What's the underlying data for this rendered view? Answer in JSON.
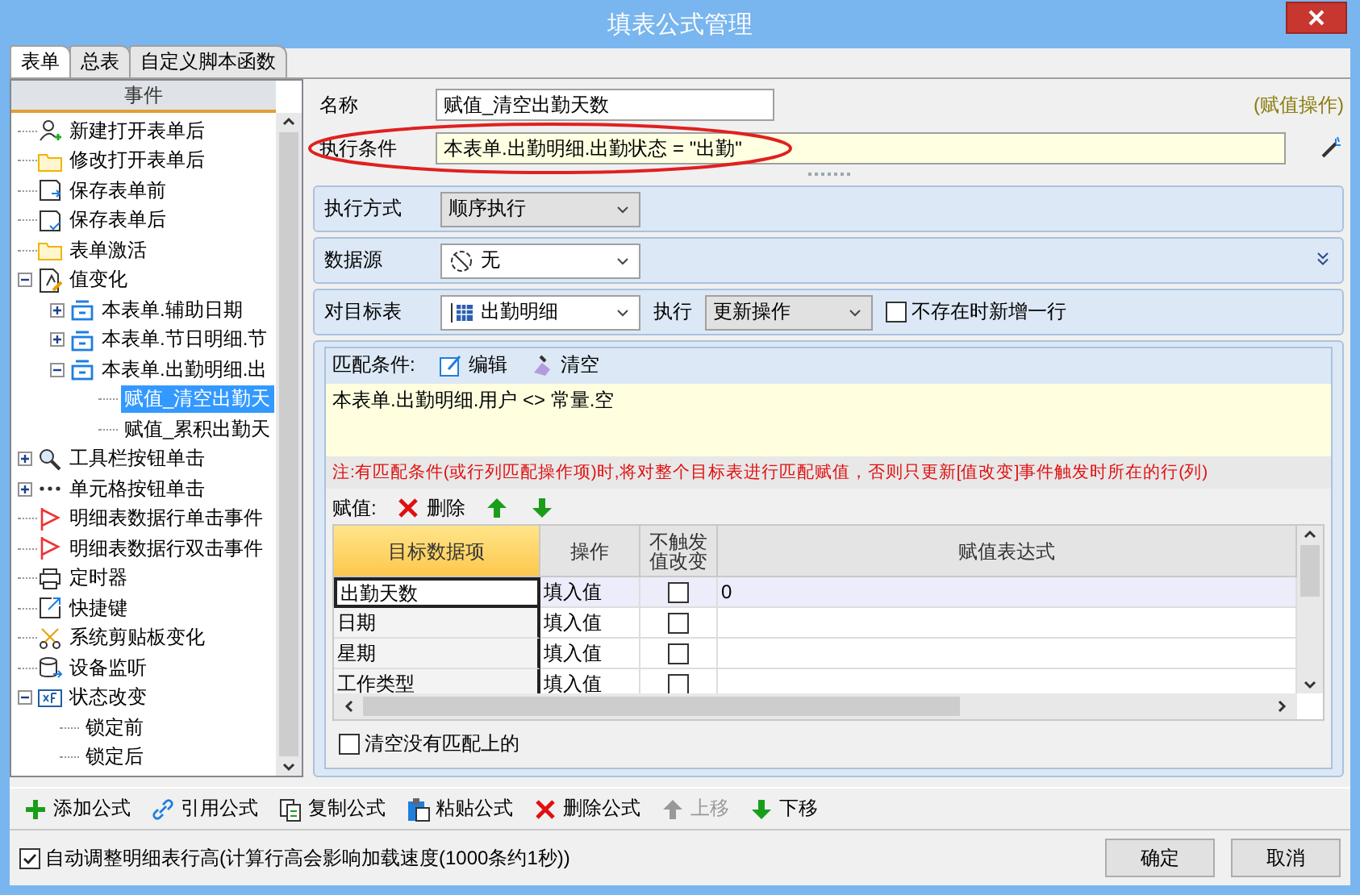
{
  "window": {
    "title": "填表公式管理"
  },
  "tabs": [
    {
      "label": "表单",
      "selected": true
    },
    {
      "label": "总表",
      "selected": false
    },
    {
      "label": "自定义脚本函数",
      "selected": false
    }
  ],
  "event_tree": {
    "header": "事件",
    "items": [
      {
        "label": "新建打开表单后",
        "selected": false
      },
      {
        "label": "修改打开表单后",
        "selected": false
      },
      {
        "label": "保存表单前",
        "selected": false
      },
      {
        "label": "保存表单后",
        "selected": false
      },
      {
        "label": "表单激活",
        "selected": false
      },
      {
        "label": "值变化",
        "selected": false,
        "expanded": true,
        "children": [
          {
            "label": "本表单.辅助日期",
            "selected": false,
            "expanded": false
          },
          {
            "label": "本表单.节日明细.节",
            "selected": false,
            "expanded": false
          },
          {
            "label": "本表单.出勤明细.出",
            "selected": false,
            "expanded": true,
            "children": [
              {
                "label": "赋值_清空出勤天",
                "selected": true
              },
              {
                "label": "赋值_累积出勤天",
                "selected": false
              }
            ]
          }
        ]
      },
      {
        "label": "工具栏按钮单击",
        "selected": false,
        "expanded": false
      },
      {
        "label": "单元格按钮单击",
        "selected": false,
        "expanded": false
      },
      {
        "label": "明细表数据行单击事件",
        "selected": false
      },
      {
        "label": "明细表数据行双击事件",
        "selected": false
      },
      {
        "label": "定时器",
        "selected": false
      },
      {
        "label": "快捷键",
        "selected": false
      },
      {
        "label": "系统剪贴板变化",
        "selected": false
      },
      {
        "label": "设备监听",
        "selected": false
      },
      {
        "label": "状态改变",
        "selected": false,
        "expanded": true,
        "children": [
          {
            "label": "锁定前",
            "selected": false
          },
          {
            "label": "锁定后",
            "selected": false
          }
        ]
      }
    ]
  },
  "form": {
    "name_label": "名称",
    "name_value": "赋值_清空出勤天数",
    "operation_type": "(赋值操作)",
    "condition_label": "执行条件",
    "condition_value": "本表单.出勤明细.出勤状态 = \"出勤\""
  },
  "exec_mode": {
    "label": "执行方式",
    "value": "顺序执行"
  },
  "datasource": {
    "label": "数据源",
    "value": "无"
  },
  "target": {
    "label": "对目标表",
    "value": "出勤明细",
    "exec_label": "执行",
    "exec_value": "更新操作",
    "add_row": {
      "label": "不存在时新增一行",
      "checked": false
    }
  },
  "match": {
    "label": "匹配条件:",
    "buttons": [
      "编辑",
      "清空"
    ],
    "expression": "本表单.出勤明细.用户 <> 常量.空",
    "note": "注:有匹配条件(或行列匹配操作项)时,将对整个目标表进行匹配赋值，否则只更新[值改变]事件触发时所在的行(列)"
  },
  "assign": {
    "label": "赋值:",
    "delete": "删除"
  },
  "grid": {
    "columns": [
      {
        "label": "目标数据项",
        "selected": true
      },
      {
        "label": "操作",
        "selected": false
      },
      {
        "label": "不触发值改变",
        "selected": false
      },
      {
        "label": "赋值表达式",
        "selected": false
      }
    ],
    "rows": [
      {
        "target": "出勤天数",
        "op": "填入值",
        "no_trigger": false,
        "expression": "0",
        "selected": true
      },
      {
        "target": "日期",
        "op": "填入值",
        "no_trigger": false,
        "selected": false
      },
      {
        "target": "星期",
        "op": "填入值",
        "no_trigger": false,
        "selected": false
      },
      {
        "target": "工作类型",
        "op": "填入值",
        "no_trigger": false,
        "selected": false
      }
    ]
  },
  "clear_unmatched": {
    "label": "清空没有匹配上的",
    "checked": false
  },
  "toolbar": [
    {
      "label": "添加公式",
      "disabled": false
    },
    {
      "label": "引用公式",
      "disabled": false
    },
    {
      "label": "复制公式",
      "disabled": false
    },
    {
      "label": "粘贴公式",
      "disabled": false
    },
    {
      "label": "删除公式",
      "disabled": false
    },
    {
      "label": "上移",
      "disabled": true
    },
    {
      "label": "下移",
      "disabled": false
    }
  ],
  "footer": {
    "auto_height": {
      "label": "自动调整明细表行高(计算行高会影响加载速度(1000条约1秒))",
      "checked": true
    },
    "buttons": [
      "确定",
      "取消"
    ]
  }
}
